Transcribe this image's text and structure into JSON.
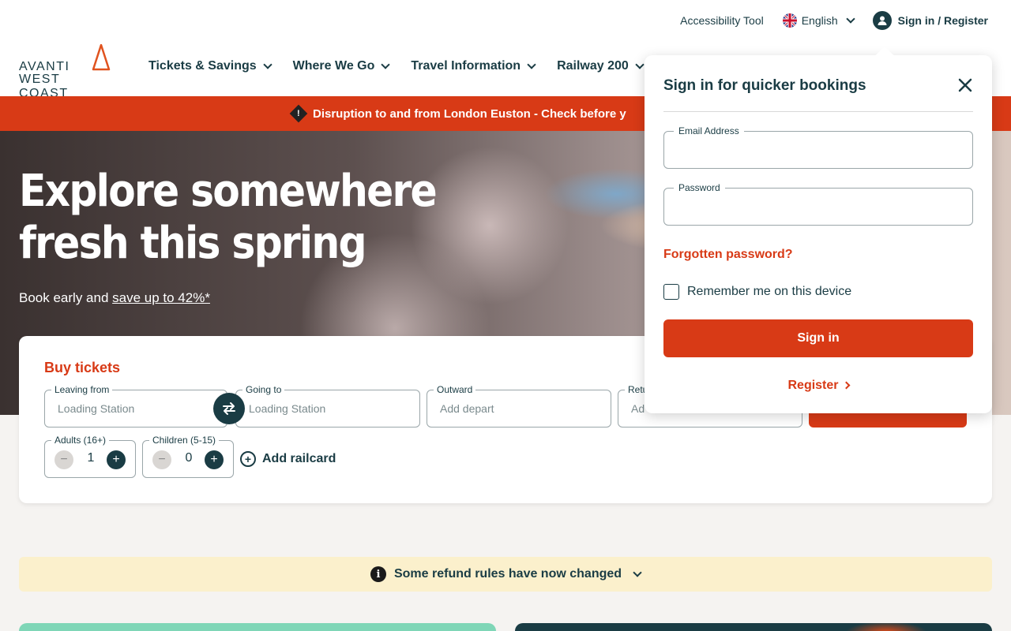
{
  "header": {
    "accessibility_tool": "Accessibility Tool",
    "language": "English",
    "sign_in_register": "Sign in / Register",
    "logo_line1": "AVANTI",
    "logo_line2": "WEST COAST",
    "nav": [
      {
        "label": "Tickets & Savings"
      },
      {
        "label": "Where We Go"
      },
      {
        "label": "Travel Information"
      },
      {
        "label": "Railway 200"
      }
    ]
  },
  "alert_banner": {
    "text": "Disruption to and from London Euston - Check before y",
    "icon": "warning-diamond-icon"
  },
  "hero": {
    "title_line1": "Explore somewhere",
    "title_line2": "fresh this spring",
    "subtitle_prefix": "Book early and ",
    "subtitle_link": "save up to 42%*"
  },
  "buy_tickets": {
    "title": "Buy tickets",
    "leaving_from": {
      "label": "Leaving from",
      "placeholder": "Loading Station"
    },
    "going_to": {
      "label": "Going to",
      "placeholder": "Loading Station"
    },
    "outward": {
      "label": "Outward",
      "placeholder": "Add depart"
    },
    "return": {
      "label": "Retu",
      "placeholder": "Ad"
    },
    "adults": {
      "label": "Adults (16+)",
      "value": "1",
      "minus": "−",
      "plus": "+"
    },
    "children": {
      "label": "Children (5-15)",
      "value": "0",
      "minus": "−",
      "plus": "+"
    },
    "add_railcard": "Add railcard",
    "railcard_icon": "+"
  },
  "refund_notice": {
    "text": "Some refund rules have now changed",
    "icon": "i"
  },
  "signin_popup": {
    "title": "Sign in for quicker bookings",
    "email_label": "Email Address",
    "password_label": "Password",
    "forgotten_password": "Forgotten password?",
    "remember_me": "Remember me on this device",
    "sign_in_button": "Sign in",
    "register_link": "Register"
  },
  "colors": {
    "brand_red": "#d83a16",
    "brand_dark": "#1a3c44",
    "notice_bg": "#fbf0cc"
  }
}
